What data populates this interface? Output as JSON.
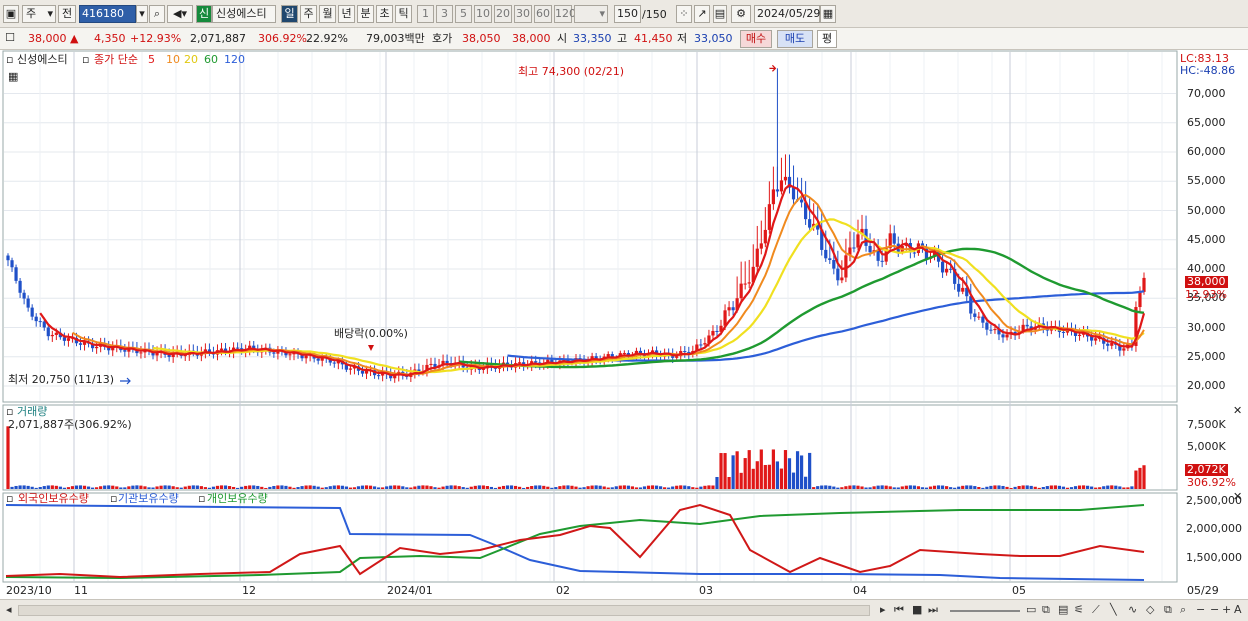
{
  "toolbar": {
    "period_label": "주",
    "prev_label": "전",
    "code_value": "416180",
    "credit_badge": "신",
    "stock_name": "신성에스티",
    "tabs": [
      "일",
      "주",
      "월",
      "년",
      "분",
      "초",
      "틱"
    ],
    "intervals": [
      "1",
      "3",
      "5",
      "10",
      "20",
      "30",
      "60",
      "120"
    ],
    "count_value": "150",
    "count_total": "/150",
    "date_value": "2024/05/29"
  },
  "quote": {
    "price": "38,000",
    "change_arrow": "▲",
    "change": "4,350",
    "change_pct": "+12.93%",
    "volume": "2,071,887",
    "volume_ratio": "306.92%",
    "turnover": "22.92%",
    "amount": "79,003백만",
    "bid_label": "호가",
    "bid1": "38,050",
    "bid2": "38,000",
    "open_label": "시",
    "open": "33,350",
    "high_label": "고",
    "high": "41,450",
    "low_label": "저",
    "low": "33,050",
    "buy_label": "매수",
    "sell_label": "매도",
    "eval_label": "평"
  },
  "price_panel": {
    "name_label": "신성에스티",
    "ma_prefix": "종가 단순",
    "ma_periods": [
      "5",
      "10",
      "20",
      "60",
      "120"
    ],
    "ma_colors": [
      "#e01818",
      "#f08a1e",
      "#f0e020",
      "#1f9a30",
      "#2c5ed8"
    ],
    "lc": "LC:83.13",
    "hc": "HC:-48.86",
    "current_price_tag": "38,000",
    "current_pct_tag": "12.93%",
    "high_marker": "최고 74,300 (02/21)",
    "low_marker": "최저 20,750 (11/13)",
    "dividend_marker": "배당락(0.00%)",
    "y_ticks": [
      "70,000",
      "65,000",
      "60,000",
      "55,000",
      "50,000",
      "45,000",
      "40,000",
      "35,000",
      "30,000",
      "25,000",
      "20,000"
    ]
  },
  "volume_panel": {
    "title": "거래량",
    "value_label": "2,071,887주(306.92%)",
    "y_ticks": [
      "7,500K",
      "5,000K",
      "2,500K"
    ],
    "current_tag": "2,072K",
    "current_pct_tag": "306.92%"
  },
  "holdings_panel": {
    "series_labels": [
      "외국인보유수량",
      "기관보유수량",
      "개인보유수량"
    ],
    "series_colors": [
      "#d01818",
      "#2c5ed8",
      "#1f9a30"
    ],
    "y_ticks": [
      "2,500,000",
      "2,000,000",
      "1,500,000"
    ]
  },
  "x_axis": {
    "labels": [
      "2023/10",
      "11",
      "12",
      "2024/01",
      "02",
      "03",
      "04",
      "05"
    ],
    "right_label": "05/29"
  },
  "chart_data": {
    "type": "candlestick",
    "title": "신성에스티",
    "y_ticks": [
      20000,
      25000,
      30000,
      35000,
      40000,
      45000,
      50000,
      55000,
      60000,
      65000,
      70000
    ],
    "annotations": [
      {
        "text": "최고 74,300 (02/21)",
        "value": 74300,
        "date": "02/21"
      },
      {
        "text": "최저 20,750 (11/13)",
        "value": 20750,
        "date": "11/13"
      },
      {
        "text": "배당락(0.00%)"
      }
    ],
    "last": {
      "date": "2024/05/29",
      "open": 33350,
      "high": 41450,
      "low": 33050,
      "close": 38000,
      "volume": 2071887
    }
  }
}
